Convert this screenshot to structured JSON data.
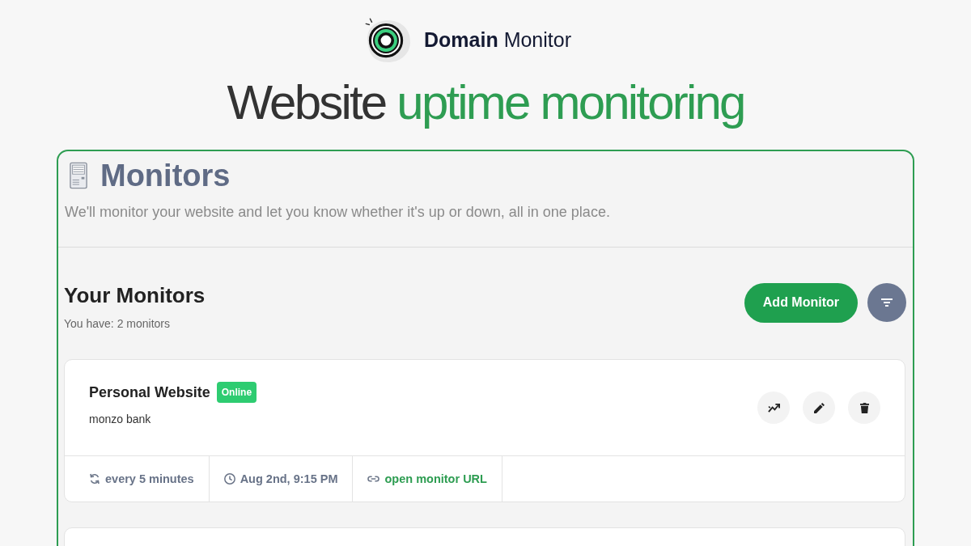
{
  "header": {
    "brand": "**Domain** Monitor",
    "title": [
      {
        "text": "Website",
        "highlight": false
      },
      {
        "text": "uptime monitoring",
        "highlight": true
      }
    ]
  },
  "panel": {
    "title": "Monitors",
    "description": "We'll monitor your website and let you know whether it's up or down, all in one place."
  },
  "monitors_section": {
    "title": "Your Monitors",
    "count": "You have: 2 monitors",
    "add_button": "Add Monitor"
  },
  "monitors": [
    {
      "clipped": false,
      "name": "Personal Website",
      "status": "Online",
      "online": true,
      "description": "monzo bank",
      "details": [
        {
          "kind": "interval",
          "text": "every 5 minutes"
        },
        {
          "kind": "last_check",
          "text": "Aug 2nd, 9:15 PM"
        },
        {
          "kind": "link",
          "text": "open monitor URL"
        }
      ]
    },
    {
      "clipped": true
    }
  ]
}
